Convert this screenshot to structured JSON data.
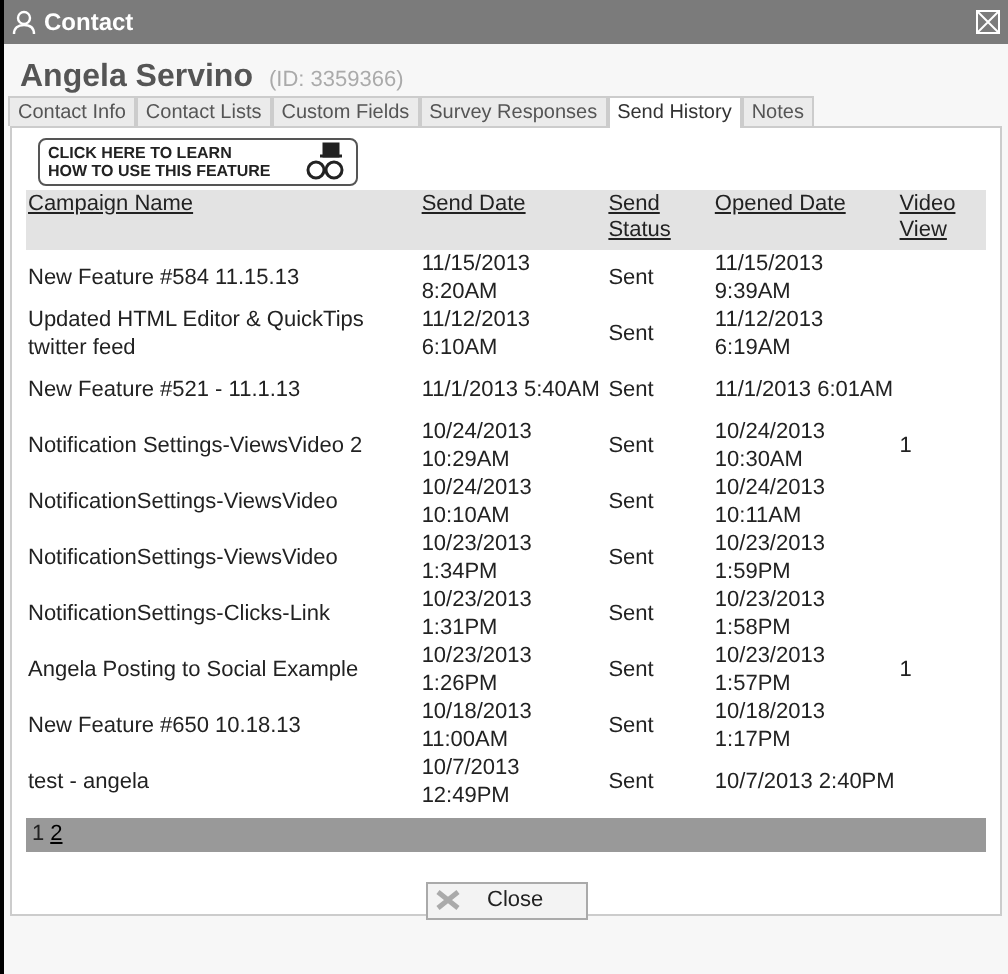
{
  "window": {
    "title": "Contact"
  },
  "contact": {
    "name": "Angela Servino",
    "id": "(ID: 3359366)"
  },
  "tabs": [
    {
      "label": "Contact Info",
      "selected": false
    },
    {
      "label": "Contact Lists",
      "selected": false
    },
    {
      "label": "Custom Fields",
      "selected": false
    },
    {
      "label": "Survey Responses",
      "selected": false
    },
    {
      "label": "Send History",
      "selected": true
    },
    {
      "label": "Notes",
      "selected": false
    }
  ],
  "help_banner": {
    "lines": [
      "CLICK HERE TO LEARN",
      "HOW TO USE THIS FEATURE"
    ]
  },
  "table": {
    "columns": [
      "Campaign Name",
      "Send Date",
      "Send Status",
      "Opened Date",
      "Video View"
    ],
    "rows": [
      [
        "New Feature #584 11.15.13",
        "11/15/2013 8:20AM",
        "Sent",
        "11/15/2013 9:39AM",
        ""
      ],
      [
        "Updated HTML Editor & QuickTips twitter feed",
        "11/12/2013 6:10AM",
        "Sent",
        "11/12/2013 6:19AM",
        ""
      ],
      [
        "New Feature #521 - 11.1.13",
        "11/1/2013 5:40AM",
        "Sent",
        "11/1/2013 6:01AM",
        ""
      ],
      [
        "Notification Settings-ViewsVideo 2",
        "10/24/2013 10:29AM",
        "Sent",
        "10/24/2013 10:30AM",
        "1"
      ],
      [
        "NotificationSettings-ViewsVideo",
        "10/24/2013 10:10AM",
        "Sent",
        "10/24/2013 10:11AM",
        ""
      ],
      [
        "NotificationSettings-ViewsVideo",
        "10/23/2013 1:34PM",
        "Sent",
        "10/23/2013 1:59PM",
        ""
      ],
      [
        "NotificationSettings-Clicks-Link",
        "10/23/2013 1:31PM",
        "Sent",
        "10/23/2013 1:58PM",
        ""
      ],
      [
        "Angela Posting to Social Example",
        "10/23/2013 1:26PM",
        "Sent",
        "10/23/2013 1:57PM",
        "1"
      ],
      [
        "New Feature #650 10.18.13",
        "10/18/2013 11:00AM",
        "Sent",
        "10/18/2013 1:17PM",
        ""
      ],
      [
        "test - angela",
        "10/7/2013 12:49PM",
        "Sent",
        "10/7/2013 2:40PM",
        ""
      ]
    ]
  },
  "pagination": [
    {
      "label": "1",
      "selected": true
    },
    {
      "label": "2",
      "selected": false
    }
  ],
  "close_button": {
    "label": "Close"
  }
}
